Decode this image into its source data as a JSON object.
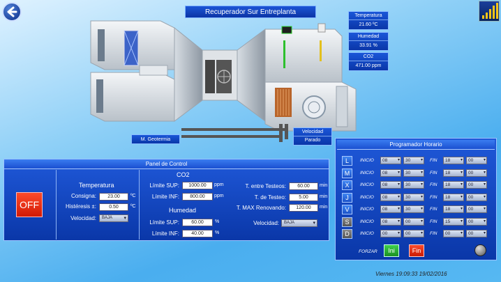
{
  "header": {
    "title": "Recuperador Sur Entreplanta"
  },
  "readouts": [
    {
      "label": "Temperatura",
      "value": "21.60 ºC"
    },
    {
      "label": "Humedad",
      "value": "33.91 %"
    },
    {
      "label": "CO2",
      "value": "471.00 ppm"
    }
  ],
  "plant": {
    "geotermia_label": "M. Geotermia",
    "velocidad_label": "Velocidad",
    "velocidad_value": "Parado"
  },
  "panel": {
    "title": "Panel de Control",
    "power_label": "OFF",
    "temperatura": {
      "title": "Temperatura",
      "consigna_label": "Consigna:",
      "consigna_value": "23.00",
      "consigna_unit": "ºC",
      "histeresis_label": "Histéresis ±:",
      "histeresis_value": "0.50",
      "histeresis_unit": "ºC",
      "velocidad_label": "Velocidad:",
      "velocidad_value": "BAJA"
    },
    "co2": {
      "title": "CO2",
      "sup_label": "Límite SUP:",
      "sup_value": "1000.00",
      "sup_unit": "ppm",
      "inf_label": "Límite INF:",
      "inf_value": "800.00",
      "inf_unit": "ppm"
    },
    "humedad": {
      "title": "Humedad",
      "sup_label": "Límite SUP:",
      "sup_value": "60.00",
      "sup_unit": "%",
      "inf_label": "Límite INF:",
      "inf_value": "40.00",
      "inf_unit": "%"
    },
    "testeo": {
      "entre_label": "T. entre Testeos:",
      "entre_value": "60.00",
      "entre_unit": "min",
      "testeo_label": "T. de Testeo:",
      "testeo_value": "5.00",
      "testeo_unit": "min",
      "max_label": "T. MAX Renovando:",
      "max_value": "120.00",
      "max_unit": "min",
      "velocidad_label": "Velocidad:",
      "velocidad_value": "BAJA"
    }
  },
  "programador": {
    "title": "Programador Horario",
    "inicio_label": "INICIO",
    "fin_label": "FIN",
    "days": [
      {
        "day": "L",
        "ih": "08",
        "im": "30",
        "fh": "18",
        "fm": "00"
      },
      {
        "day": "M",
        "ih": "08",
        "im": "30",
        "fh": "18",
        "fm": "00"
      },
      {
        "day": "X",
        "ih": "08",
        "im": "30",
        "fh": "18",
        "fm": "00"
      },
      {
        "day": "J",
        "ih": "08",
        "im": "30",
        "fh": "18",
        "fm": "00"
      },
      {
        "day": "V",
        "ih": "08",
        "im": "30",
        "fh": "18",
        "fm": "00"
      },
      {
        "day": "S",
        "ih": "08",
        "im": "00",
        "fh": "15",
        "fm": "00"
      },
      {
        "day": "D",
        "ih": "00",
        "im": "00",
        "fh": "00",
        "fm": "00"
      }
    ],
    "forzar_label": "FORZAR",
    "ini_label": "Ini",
    "fin_button_label": "Fin"
  },
  "status": {
    "datetime": "Viernes   19:09:33  19/02/2016"
  }
}
